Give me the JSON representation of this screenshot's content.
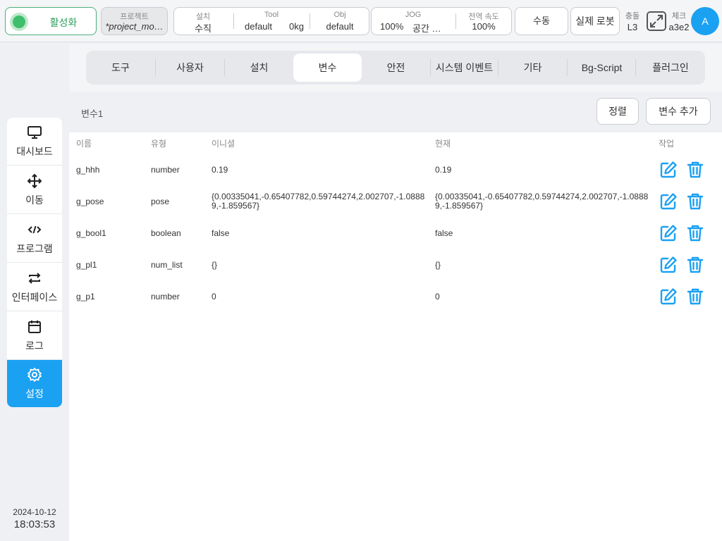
{
  "topbar": {
    "activate_label": "활성화",
    "project_title": "프로젝트",
    "project_name": "*project_mo…",
    "install_title": "설치",
    "install_value": "수직",
    "tool_title": "Tool",
    "tool_value": "default",
    "tool_load": "0kg",
    "obj_title": "Obj",
    "obj_value": "default",
    "jog_title": "JOG",
    "jog_value": "100%",
    "jog_space": "공간 …",
    "global_speed_title": "전역 속도",
    "global_speed_value": "100%",
    "manual_label": "수동",
    "real_robot_label": "실제 로봇",
    "collision_title": "충돌",
    "collision_value": "L3",
    "check_title": "체크",
    "check_value": "a3e2",
    "avatar_letter": "A"
  },
  "sidebar": {
    "items": [
      {
        "label": "대시보드",
        "icon": "monitor-icon"
      },
      {
        "label": "이동",
        "icon": "move-icon"
      },
      {
        "label": "프로그램",
        "icon": "code-icon"
      },
      {
        "label": "인터페이스",
        "icon": "swap-icon"
      },
      {
        "label": "로그",
        "icon": "calendar-icon"
      },
      {
        "label": "설정",
        "icon": "gear-icon"
      }
    ],
    "date": "2024-10-12",
    "time": "18:03:53"
  },
  "tabs": [
    "도구",
    "사용자",
    "설치",
    "변수",
    "안전",
    "시스템 이벤트",
    "기타",
    "Bg-Script",
    "플러그인"
  ],
  "active_tab": "변수",
  "variables": {
    "title": "변수1",
    "sort_label": "정렬",
    "add_label": "변수 추가",
    "columns": [
      "이름",
      "유형",
      "이니셜",
      "현재",
      "작업"
    ],
    "rows": [
      {
        "name": "g_hhh",
        "type": "number",
        "initial": "0.19",
        "current": "0.19"
      },
      {
        "name": "g_pose",
        "type": "pose",
        "initial": "{0.00335041,-0.65407782,0.59744274,2.002707,-1.08889,-1.859567}",
        "current": "{0.00335041,-0.65407782,0.59744274,2.002707,-1.08889,-1.859567}"
      },
      {
        "name": "g_bool1",
        "type": "boolean",
        "initial": "false",
        "current": "false"
      },
      {
        "name": "g_pl1",
        "type": "num_list",
        "initial": "{}",
        "current": "{}"
      },
      {
        "name": "g_p1",
        "type": "number",
        "initial": "0",
        "current": "0"
      }
    ]
  },
  "colors": {
    "accent": "#1ba1f2",
    "active_green": "#3fbf6c"
  }
}
